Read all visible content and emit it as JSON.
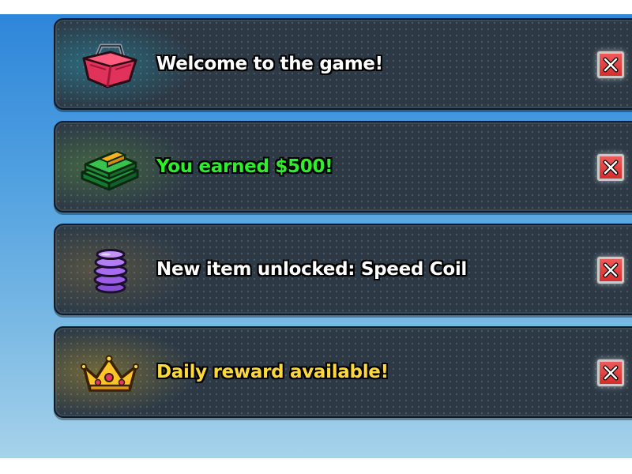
{
  "notifications": [
    {
      "message": "Welcome to the game!",
      "icon": "shopping-basket-icon",
      "text_color": "#ffffff",
      "close_glyph": "×"
    },
    {
      "message": "You earned $500!",
      "icon": "cash-stack-icon",
      "text_color": "#2ef02a",
      "close_glyph": "×"
    },
    {
      "message": "New item unlocked: Speed Coil",
      "icon": "speed-coil-icon",
      "text_color": "#ffffff",
      "close_glyph": "×"
    },
    {
      "message": "Daily reward available!",
      "icon": "crown-icon",
      "text_color": "#ffd93a",
      "close_glyph": "×"
    }
  ],
  "colors": {
    "panel": "#2d3a46",
    "close_button": "#e04040",
    "sky_top": "#2f86d9",
    "sky_bottom": "#a6d2ea"
  }
}
